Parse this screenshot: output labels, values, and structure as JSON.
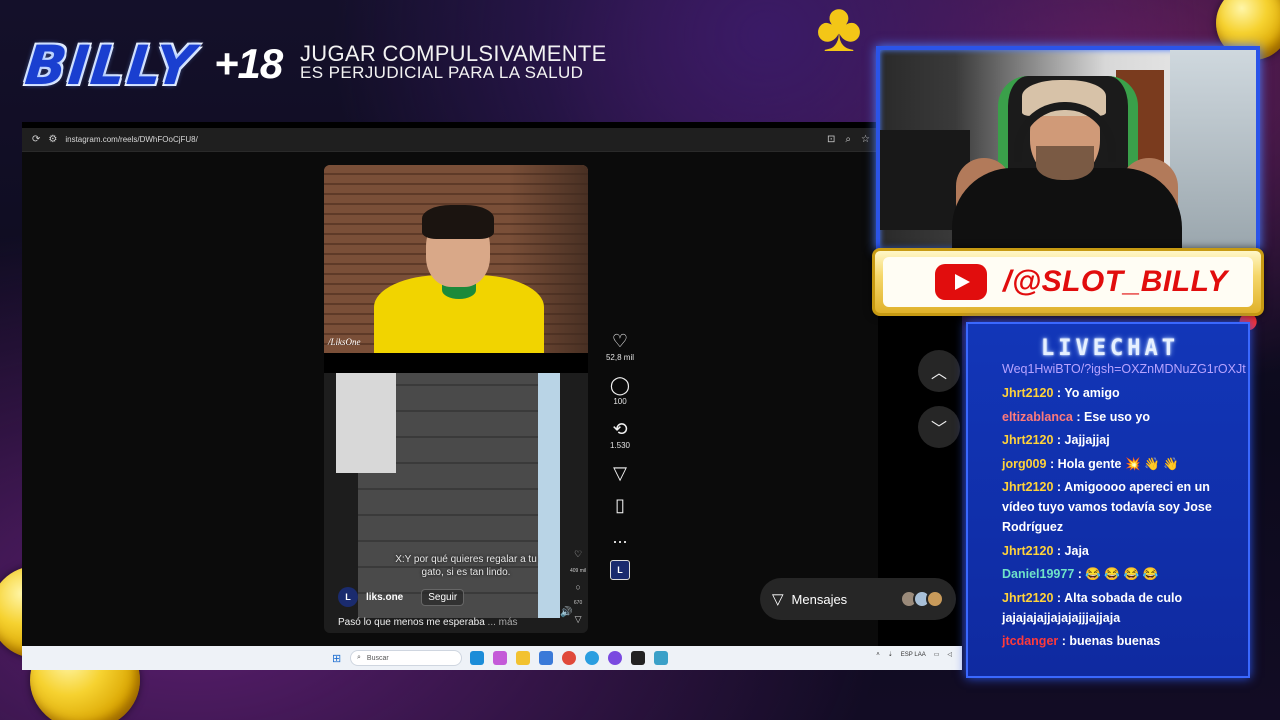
{
  "overlay": {
    "logo_text": "BILLY",
    "age_badge": "+18",
    "warning_line1": "JUGAR COMPULSIVAMENTE",
    "warning_line2": "ES PERJUDICIAL PARA LA SALUD",
    "youtube_handle": "/@SLOT_BILLY",
    "chat_title": "LIVECHAT"
  },
  "browser": {
    "url": "instagram.com/reels/DWhFOoCjFU8/"
  },
  "reel": {
    "stream_tag": "/LiksOne",
    "caption": "X:Y por qué quieres regalar a tu gato, si es tan lindo.",
    "author": "liks.one",
    "author_initial": "L",
    "follow_label": "Seguir",
    "description": "Pasó lo que menos me esperaba",
    "more_label": "... más",
    "mini_counts": {
      "likes": "409 mil",
      "comments": "670"
    }
  },
  "actions": {
    "likes": "52,8 mil",
    "comments": "100",
    "reposts": "1.530",
    "more": "..."
  },
  "messages_button": {
    "label": "Mensajes"
  },
  "taskbar": {
    "search_placeholder": "Buscar",
    "lang": "ESP LAA"
  },
  "chat": [
    {
      "plain": "Weq1HwiBTO/?igsh=OXZnMDNuZG1rOXJt"
    },
    {
      "user": "Jhrt2120",
      "color": "#ffd23a",
      "text": " : Yo amigo"
    },
    {
      "user": "eltizablanca",
      "color": "#ff7a7a",
      "text": " : Ese uso yo"
    },
    {
      "user": "Jhrt2120",
      "color": "#ffd23a",
      "text": " : Jajjajjaj"
    },
    {
      "user": "jorg009",
      "color": "#ffd23a",
      "text": " : Hola gente 💥 👋 👋"
    },
    {
      "user": "Jhrt2120",
      "color": "#ffd23a",
      "text": " : Amigoooo apereci en un vídeo tuyo vamos todavía soy Jose Rodríguez"
    },
    {
      "user": "Jhrt2120",
      "color": "#ffd23a",
      "text": " : Jaja"
    },
    {
      "user": "Daniel19977",
      "color": "#6fe3c8",
      "text": " : 😂 😂 😂 😂"
    },
    {
      "user": "Jhrt2120",
      "color": "#ffd23a",
      "text": " : Alta sobada de culo jajajajajjajajajjjajjaja"
    },
    {
      "user": "jtcdanger",
      "color": "#ff3a3a",
      "text": " : buenas buenas"
    }
  ]
}
